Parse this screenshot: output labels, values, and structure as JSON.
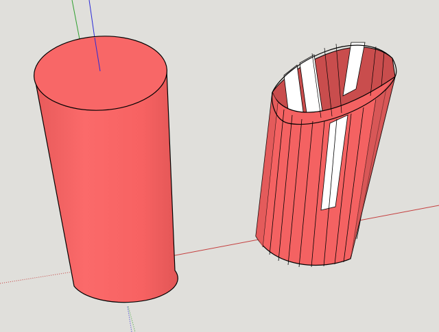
{
  "viewport": {
    "background": "#e0dfdb"
  },
  "axes": {
    "red": "#c43c3c",
    "green": "#2ea02e",
    "blue": "#2a2ad8"
  },
  "materials": {
    "face_front": "#f76363",
    "face_light": "#fa6b6b",
    "face_shade": "#e45a5a",
    "face_back": "#c94d4d",
    "edge": "#000000"
  },
  "scene_objects": [
    {
      "label": "solid-cylinder",
      "icon": "cylinder-icon"
    },
    {
      "label": "hollow-cylinder",
      "icon": "tube-icon"
    }
  ]
}
